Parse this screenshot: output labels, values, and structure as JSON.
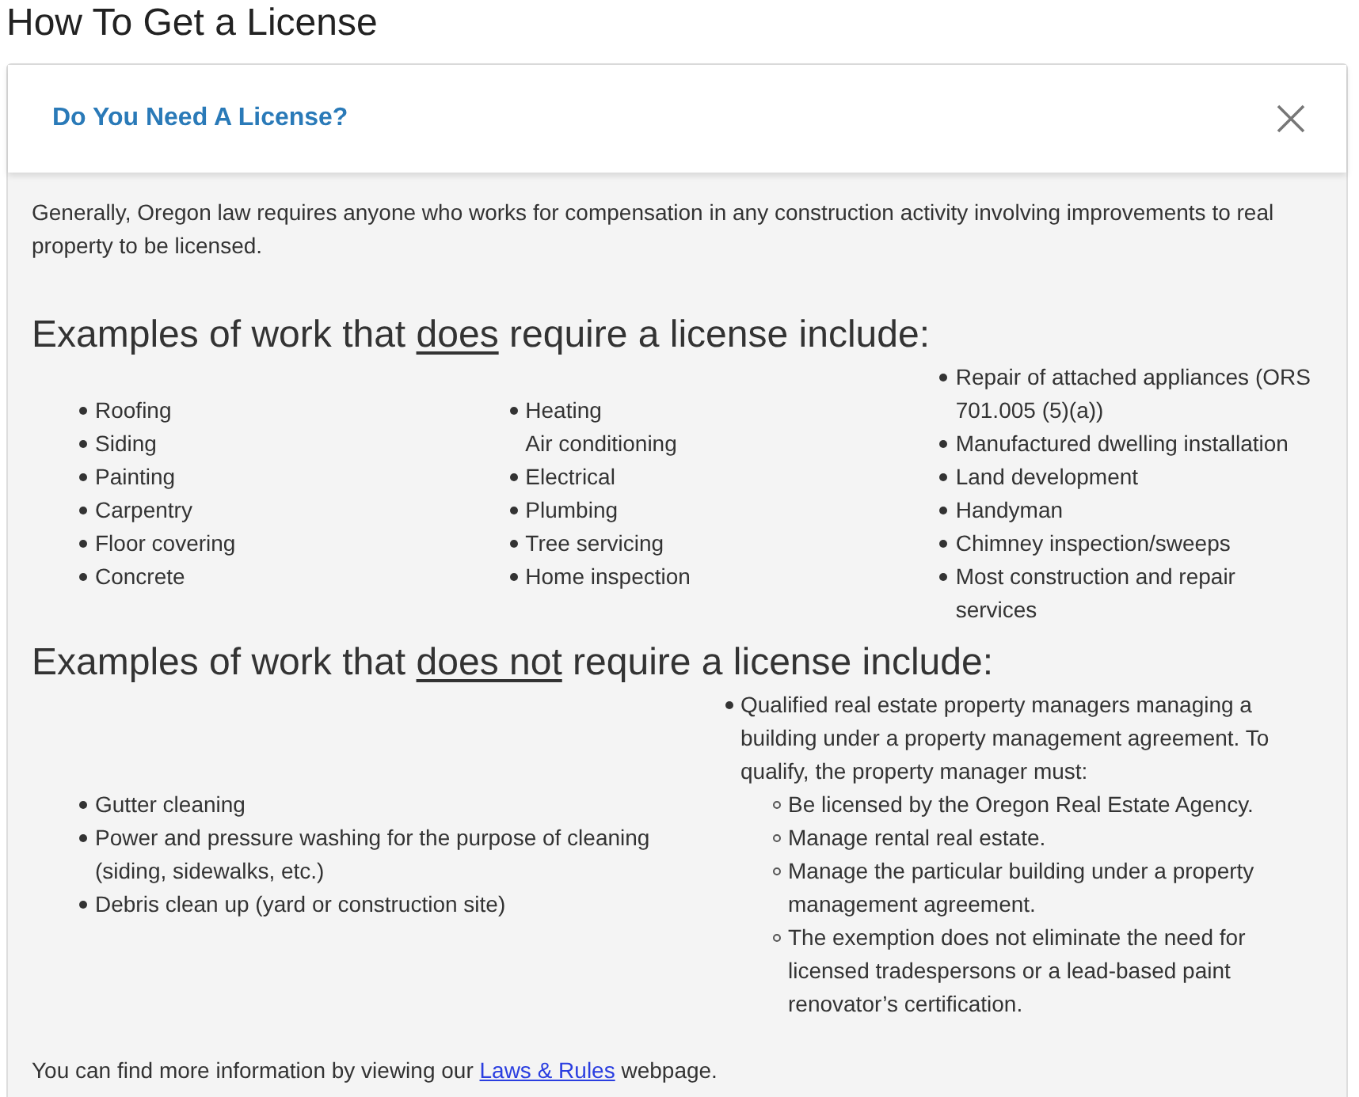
{
  "page_title": "How To Get a License",
  "panel": {
    "title": "Do You Need A License?"
  },
  "intro": "Generally, Oregon law requires anyone who works for compensation in any construction activity involving improvements to real property to be licensed.",
  "sections": [
    {
      "heading": {
        "lead": "Examples of work that",
        "emphasis": "does",
        "tail": "require a license include:"
      },
      "columns": [
        [
          {
            "text": "Roofing"
          },
          {
            "text": "Siding"
          },
          {
            "text": "Painting"
          },
          {
            "text": "Carpentry"
          },
          {
            "text": "Floor covering"
          },
          {
            "text": "Concrete"
          }
        ],
        [
          {
            "text": "Heating\nAir conditioning"
          },
          {
            "text": "Electrical"
          },
          {
            "text": "Plumbing"
          },
          {
            "text": "Tree servicing"
          },
          {
            "text": "Home inspection"
          }
        ],
        [
          {
            "text": "Repair of attached appliances (ORS 701.005 (5)(a))"
          },
          {
            "text": "Manufactured dwelling installation"
          },
          {
            "text": "Land development"
          },
          {
            "text": "Handyman"
          },
          {
            "text": "Chimney inspection/sweeps"
          },
          {
            "text": "Most construction and repair services"
          }
        ]
      ]
    },
    {
      "heading": {
        "lead": "Examples of work that",
        "emphasis": "does not",
        "tail": "require a license include:"
      },
      "columns": [
        [
          {
            "text": "Gutter cleaning"
          },
          {
            "text": "Power and pressure washing for the purpose of cleaning (siding, sidewalks, etc.)"
          },
          {
            "text": "Debris clean up (yard or construction site)"
          }
        ],
        [
          {
            "text": "Qualified real estate property managers managing a building under a property management agreement. To qualify, the property manager must:",
            "children": [
              {
                "text": "Be licensed by the Oregon Real Estate Agency."
              },
              {
                "text": "Manage rental real estate."
              },
              {
                "text": "Manage the particular building under a property management agreement."
              },
              {
                "text": "The exemption does not eliminate the need for licensed tradespersons or a lead-based paint renovator’s certification."
              }
            ]
          }
        ]
      ]
    }
  ],
  "footer": {
    "before": "You can find more information by viewing our",
    "link": "Laws & Rules",
    "after": "webpage."
  }
}
